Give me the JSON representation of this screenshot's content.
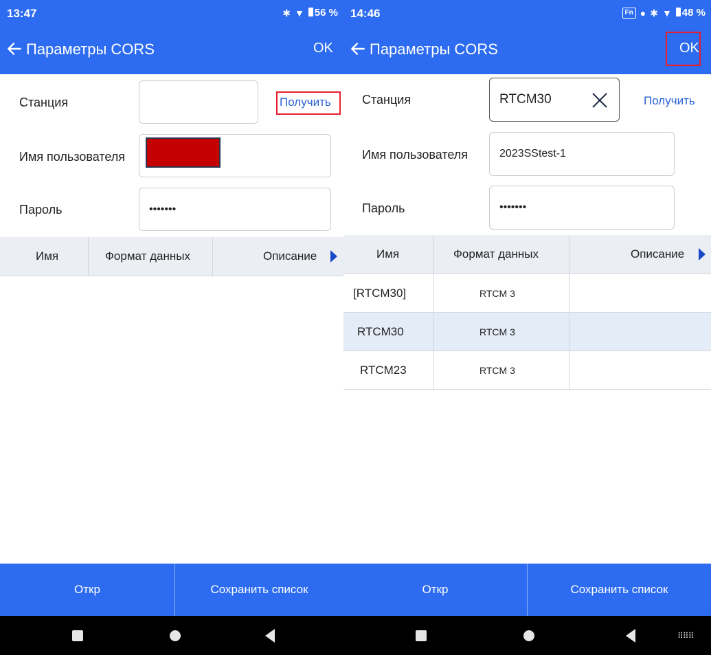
{
  "left": {
    "status": {
      "time": "13:47",
      "battery": "56 %"
    },
    "title": "Параметры CORS",
    "ok_label": "OK",
    "station": {
      "label": "Станция",
      "value": "",
      "get_label": "Получить"
    },
    "username": {
      "label": "Имя пользователя",
      "value": ""
    },
    "password": {
      "label": "Пароль",
      "value": "•••••••"
    },
    "table": {
      "headers": [
        "Имя",
        "Формат данных",
        "Описание"
      ],
      "rows": []
    },
    "bottom": {
      "open_label": "Откр",
      "save_label": "Сохранить список"
    }
  },
  "right": {
    "status": {
      "time": "14:46",
      "fn_badge": "Fn",
      "battery": "48 %"
    },
    "title": "Параметры CORS",
    "ok_label": "OK",
    "station": {
      "label": "Станция",
      "value": "RTCM30",
      "get_label": "Получить"
    },
    "username": {
      "label": "Имя пользователя",
      "value": "2023SStest-1"
    },
    "password": {
      "label": "Пароль",
      "value": "•••••••"
    },
    "table": {
      "headers": [
        "Имя",
        "Формат данных",
        "Описание"
      ],
      "rows": [
        {
          "name": "[RTCM30]",
          "format": "RTCM 3",
          "description": ""
        },
        {
          "name": "RTCM30",
          "format": "RTCM 3",
          "description": ""
        },
        {
          "name": "RTCM23",
          "format": "RTCM 3",
          "description": ""
        }
      ]
    },
    "bottom": {
      "open_label": "Откр",
      "save_label": "Сохранить список"
    }
  },
  "colors": {
    "primary": "#2d6cf0",
    "highlight_box": "#e51f2b",
    "link": "#2a64d6",
    "selected_row": "#e4ecf7"
  }
}
